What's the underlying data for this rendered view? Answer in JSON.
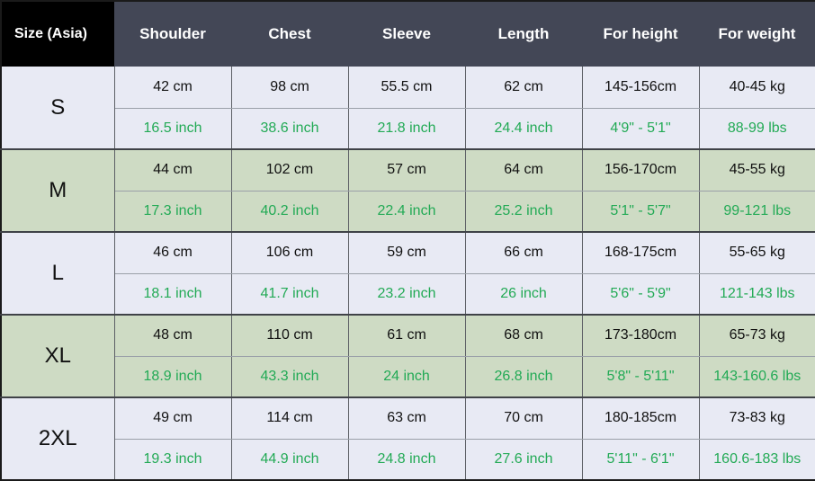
{
  "table": {
    "headers": [
      "Size (Asia)",
      "Shoulder",
      "Chest",
      "Sleeve",
      "Length",
      "For height",
      "For weight"
    ],
    "colors": {
      "size_header_bg": "#000000",
      "header_bg": "#434756",
      "header_text": "#ffffff",
      "row_light_bg": "#e8eaf4",
      "row_green_bg": "#cedbc4",
      "cm_text": "#111111",
      "inch_text": "#22aa55",
      "border": "#5d6066",
      "outer_border": "#1a1a1a"
    },
    "rows": [
      {
        "size": "S",
        "band": "light",
        "cm": [
          "42 cm",
          "98 cm",
          "55.5 cm",
          "62 cm",
          "145-156cm",
          "40-45 kg"
        ],
        "inch": [
          "16.5 inch",
          "38.6 inch",
          "21.8 inch",
          "24.4 inch",
          "4'9\" - 5'1\"",
          "88-99 lbs"
        ]
      },
      {
        "size": "M",
        "band": "green",
        "cm": [
          "44 cm",
          "102 cm",
          "57 cm",
          "64 cm",
          "156-170cm",
          "45-55 kg"
        ],
        "inch": [
          "17.3 inch",
          "40.2 inch",
          "22.4 inch",
          "25.2 inch",
          "5'1\" - 5'7\"",
          "99-121 lbs"
        ]
      },
      {
        "size": "L",
        "band": "light",
        "cm": [
          "46 cm",
          "106 cm",
          "59 cm",
          "66 cm",
          "168-175cm",
          "55-65 kg"
        ],
        "inch": [
          "18.1 inch",
          "41.7 inch",
          "23.2 inch",
          "26 inch",
          "5'6\" - 5'9\"",
          "121-143 lbs"
        ]
      },
      {
        "size": "XL",
        "band": "green",
        "cm": [
          "48 cm",
          "110 cm",
          "61 cm",
          "68 cm",
          "173-180cm",
          "65-73 kg"
        ],
        "inch": [
          "18.9 inch",
          "43.3 inch",
          "24 inch",
          "26.8 inch",
          "5'8\" - 5'11\"",
          "143-160.6 lbs"
        ]
      },
      {
        "size": "2XL",
        "band": "light",
        "cm": [
          "49 cm",
          "114 cm",
          "63 cm",
          "70 cm",
          "180-185cm",
          "73-83 kg"
        ],
        "inch": [
          "19.3 inch",
          "44.9 inch",
          "24.8 inch",
          "27.6 inch",
          "5'11\" - 6'1\"",
          "160.6-183 lbs"
        ]
      }
    ]
  }
}
